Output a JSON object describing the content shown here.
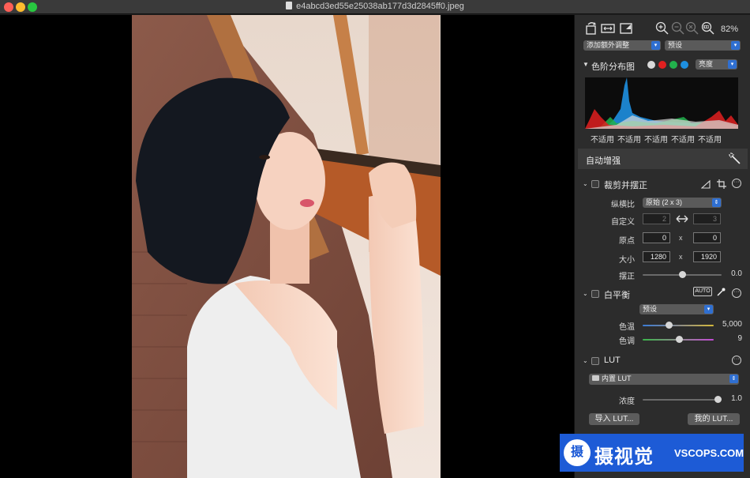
{
  "window": {
    "title": "e4abcd3ed55e25038ab177d3d2845ff0.jpeg"
  },
  "toolbar": {
    "zoom": "82%"
  },
  "popups": {
    "add_adjust": "添加额外调整",
    "preset": "预设"
  },
  "histogram": {
    "title": "色阶分布图",
    "mode": "亮度",
    "values": [
      "不适用",
      "不适用",
      "不适用",
      "不适用",
      "不适用"
    ],
    "colors": {
      "white": "#d9d9d9",
      "red": "#e02020",
      "green": "#22b14c",
      "blue": "#1e8fe0"
    }
  },
  "auto_enhance": {
    "label": "自动增强"
  },
  "crop": {
    "title": "裁剪并摆正",
    "aspect_label": "纵横比",
    "aspect_value": "原始 (2 x 3)",
    "custom_label": "自定义",
    "custom_w": "2",
    "custom_h": "3",
    "origin_label": "原点",
    "origin_x": "0",
    "origin_y": "0",
    "size_label": "大小",
    "size_w": "1280",
    "size_h": "1920",
    "x_sep": "x",
    "straighten_label": "摆正",
    "straighten_value": "0.0",
    "straighten_level": 0.5
  },
  "white_balance": {
    "title": "白平衡",
    "auto_badge": "AUTO",
    "preset": "预设",
    "temp_label": "色温",
    "temp_value": "5,000",
    "temp_level": 0.36,
    "tint_label": "色调",
    "tint_value": "9",
    "tint_level": 0.52
  },
  "lut": {
    "title": "LUT",
    "builtin": "内置 LUT",
    "density_label": "浓度",
    "density_value": "1.0",
    "density_level": 1.0,
    "import_btn": "导入 LUT...",
    "my_btn": "我的 LUT..."
  },
  "watermark": {
    "logo_char": "摄",
    "cn": "摄视觉",
    "en": "VSCOPS.COM"
  }
}
